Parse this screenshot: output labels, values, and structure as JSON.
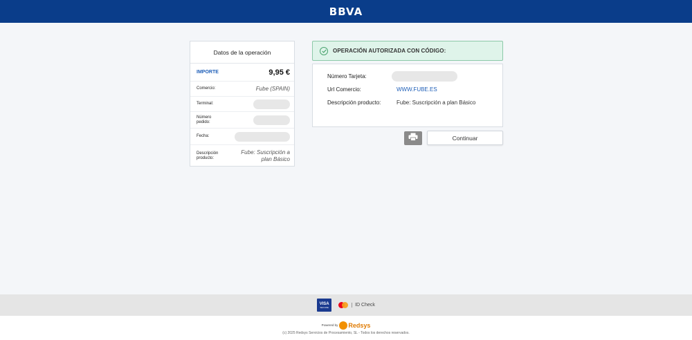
{
  "header": {
    "logo": "BBVA"
  },
  "summary": {
    "title": "Datos de la operación",
    "importe_label": "IMPORTE",
    "importe_value": "9,95 €",
    "comercio_label": "Comercio:",
    "comercio_value": "Fube (SPAIN)",
    "terminal_label": "Terminal:",
    "pedido_label": "Número pedido:",
    "fecha_label": "Fecha:",
    "descripcion_label": "Descripción producto:",
    "descripcion_value": "Fube: Suscripción a plan Básico"
  },
  "alert": {
    "text": "OPERACIÓN AUTORIZADA CON CÓDIGO:"
  },
  "details": {
    "tarjeta_label": "Número Tarjeta:",
    "url_label": "Url Comercio:",
    "url_value": "WWW.FUBE.ES",
    "descripcion_label": "Descripción producto:",
    "descripcion_value": "Fube: Suscripción a plan Básico"
  },
  "actions": {
    "continue_label": "Continuar"
  },
  "brands": {
    "visa_top": "VISA",
    "visa_bottom": "SECURE",
    "idcheck": "ID Check"
  },
  "footer": {
    "powered_by": "Powered by",
    "redsys": "Redsys",
    "copyright": "(c) 2025 Redsys Servicios de Procesamiento, SL - Todos los derechos reservados."
  },
  "colors": {
    "header_bg": "#0a3d8a",
    "link": "#1f5fb8",
    "success_bg": "#dff4ea",
    "success_border": "#8cc9a8"
  }
}
